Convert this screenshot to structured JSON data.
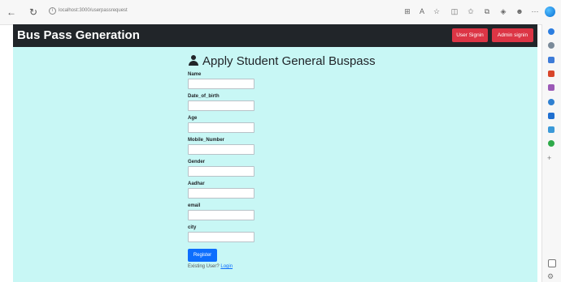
{
  "browser": {
    "back_icon": "←",
    "refresh_icon": "↻",
    "info_icon": "i",
    "url": "localhost:3000/userpassrequest",
    "toolbar_icons": [
      "grid-icon",
      "read-aloud-icon",
      "favorite-icon",
      "split-screen-icon",
      "favorites-icon",
      "collections-icon",
      "extensions-icon",
      "profile-icon",
      "more-icon"
    ],
    "toolbar_glyphs": [
      "⊞",
      "A",
      "☆",
      "◫",
      "✩",
      "⧉",
      "◈",
      "☻",
      "⋯"
    ]
  },
  "navbar": {
    "brand": "Bus Pass Generation",
    "user_signin": "User Signin",
    "admin_signin": "Admin signin",
    "button_color": "#dc3545",
    "bg_color": "#212529"
  },
  "form": {
    "title": "Apply Student General Buspass",
    "fields": [
      {
        "label": "Name",
        "value": ""
      },
      {
        "label": "Date_of_birth",
        "value": ""
      },
      {
        "label": "Age",
        "value": ""
      },
      {
        "label": "Mobile_Number",
        "value": ""
      },
      {
        "label": "Gender",
        "value": ""
      },
      {
        "label": "Aadhar",
        "value": ""
      },
      {
        "label": "email",
        "value": ""
      },
      {
        "label": "city",
        "value": ""
      }
    ],
    "register": "Register",
    "existing_user": "Existing User?",
    "login": "Login",
    "bg_color": "#c8f7f5"
  },
  "sidebar": {
    "icons": [
      "bell-icon",
      "search-icon",
      "shopping-icon",
      "toolbox-icon",
      "games-icon",
      "office-icon",
      "outlook-icon",
      "telegram-icon",
      "drop-icon",
      "add-icon",
      "split-view-icon",
      "settings-icon"
    ]
  }
}
